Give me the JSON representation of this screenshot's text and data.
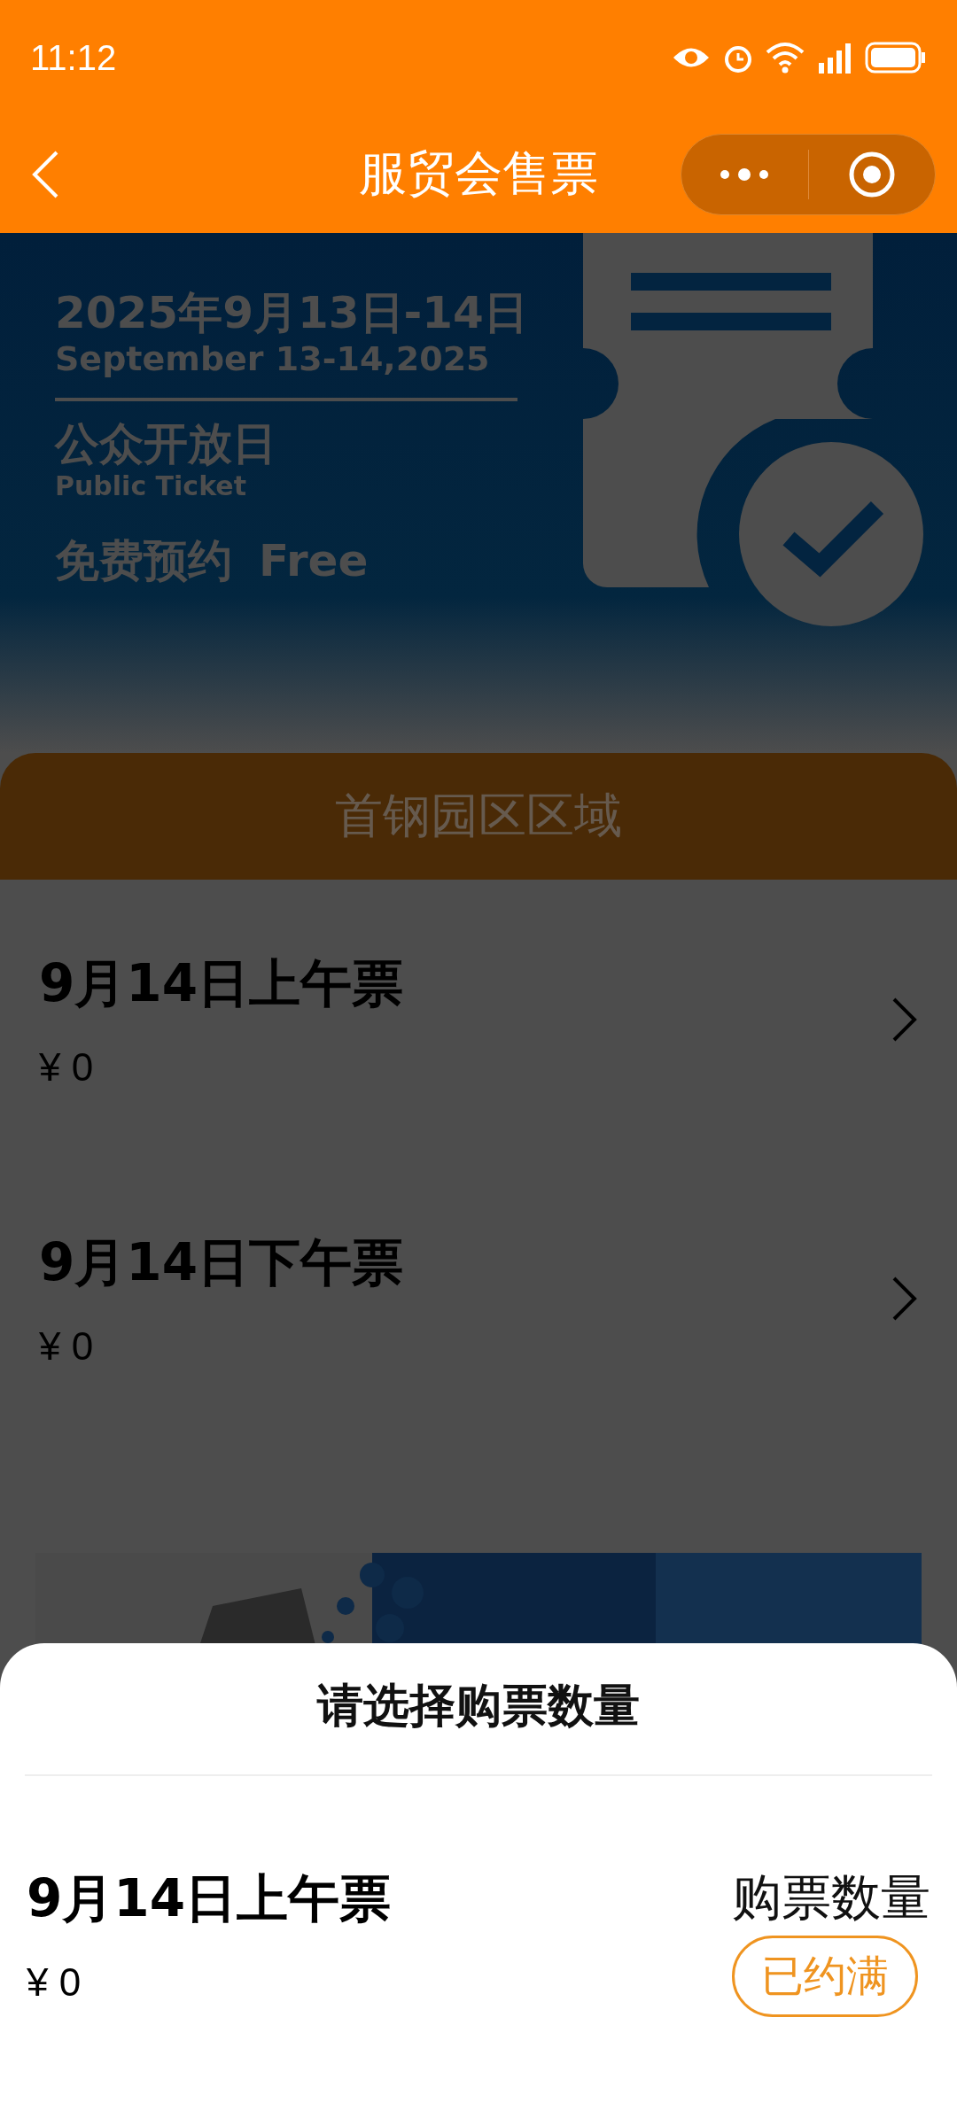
{
  "status_bar": {
    "time": "11:12"
  },
  "nav": {
    "title": "服贸会售票"
  },
  "banner": {
    "date_cn": "2025年9月13日-14日",
    "date_en": "September 13-14,2025",
    "label_cn": "公众开放日",
    "label_en": "Public Ticket",
    "free_cn": "免费预约",
    "free_en": "Free"
  },
  "area_tab": {
    "label": "首钢园区区域"
  },
  "tickets": [
    {
      "title": "9月14日上午票",
      "price": "¥ 0"
    },
    {
      "title": "9月14日下午票",
      "price": "¥ 0"
    }
  ],
  "sheet": {
    "title": "请选择购票数量",
    "ticket": {
      "title": "9月14日上午票",
      "price": "¥ 0"
    },
    "quantity_label": "购票数量",
    "status_button": "已约满"
  }
}
